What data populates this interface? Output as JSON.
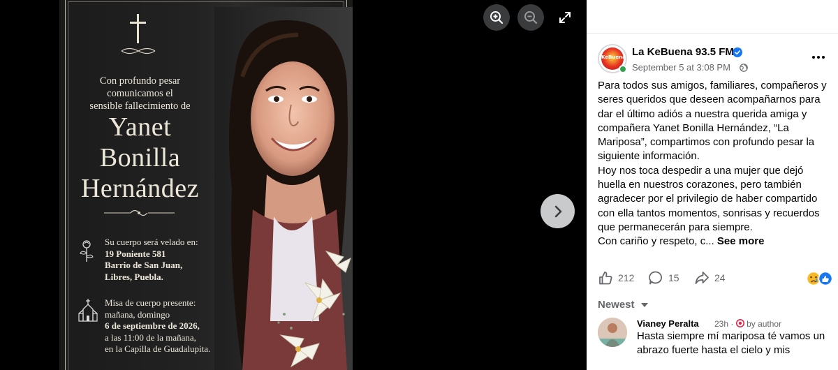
{
  "viewer": {
    "card": {
      "intro_lines": [
        "Con profundo pesar",
        "comunicamos el",
        "sensible fallecimiento de"
      ],
      "name_lines": [
        "Yanet",
        "Bonilla",
        "Hernández"
      ],
      "wake_lines": [
        "Su cuerpo será velado en:",
        "19 Poniente 581",
        "Barrio de San Juan,",
        "Libres, Puebla."
      ],
      "mass_lines": [
        "Misa de cuerpo presente:",
        "mañana, domingo",
        "6 de septiembre de 2026,",
        "a las 11:00 de la mañana,",
        "en la Capilla de Guadalupita."
      ]
    },
    "icons": {
      "zoom_in": "zoom-in-icon",
      "zoom_out": "zoom-out-icon",
      "expand": "expand-icon",
      "next": "chevron-right-icon"
    }
  },
  "post": {
    "page_name": "La KeBuena 93.5 FM",
    "avatar_text": "KeBuena",
    "time": "September 5 at 3:08 PM",
    "text_paragraph_1": "Para todos sus amigos, familiares, compañeros y seres queridos que deseen acompañarnos para dar el último adiós a nuestra querida amiga y compañera Yanet Bonilla Hernández, “La Mariposa”, compartimos con profundo pesar la siguiente información.",
    "text_paragraph_2": "Hoy nos toca despedir a una mujer que dejó huella en nuestros corazones, pero también agradecer por el privilegio de haber compartido con ella tantos momentos, sonrisas y recuerdos que permanecerán para siempre.",
    "text_paragraph_3": "Con cariño y respeto, c...",
    "see_more": "See more",
    "likes": "212",
    "comments": "15",
    "shares": "24"
  },
  "comments_section": {
    "sort_label": "Newest",
    "comments": [
      {
        "author": "Vianey Peralta",
        "time": "23h",
        "badge": "by author",
        "text": "Hasta siempre mí mariposa té vamos un abrazo fuerte hasta el cielo y mis"
      }
    ]
  },
  "colors": {
    "accent_blue": "#1877f2",
    "text_primary": "#050505",
    "text_secondary": "#65676b",
    "online_green": "#31a24c",
    "card_text": "#ece7d9"
  }
}
